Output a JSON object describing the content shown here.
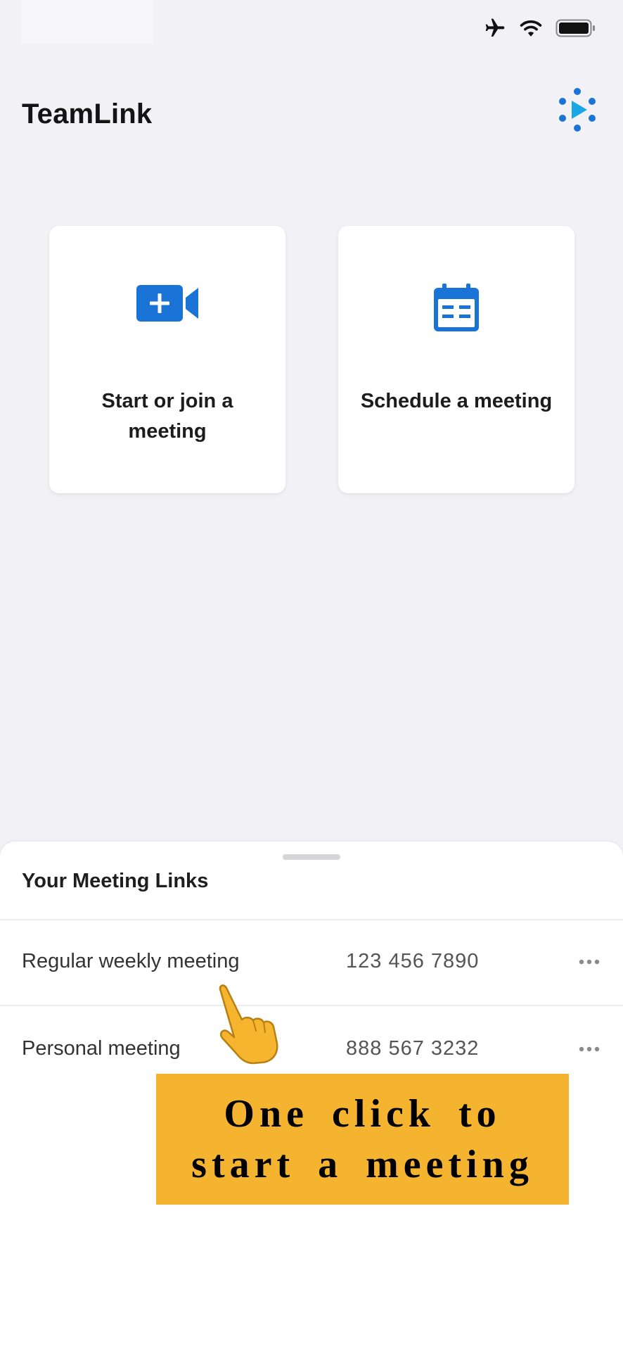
{
  "header": {
    "title": "TeamLink",
    "logo_icon": "teamlink-dots-play-logo"
  },
  "status_bar": {
    "icons": [
      "airplane-icon",
      "wifi-icon",
      "battery-icon"
    ]
  },
  "cards": [
    {
      "label": "Start or join a meeting",
      "icon": "video-plus-icon",
      "icon_color": "#1a73d6"
    },
    {
      "label": "Schedule a meeting",
      "icon": "calendar-icon",
      "icon_color": "#1a73d6"
    }
  ],
  "meeting_links": {
    "title": "Your Meeting Links",
    "items": [
      {
        "name": "Regular weekly meeting",
        "id": "123 456 7890",
        "more_icon": "more-horizontal-icon"
      },
      {
        "name": "Personal meeting",
        "id": "888 567 3232",
        "more_icon": "more-horizontal-icon"
      }
    ]
  },
  "overlay": {
    "pointer_icon": "hand-pointer-icon",
    "banner_line1": "One click to",
    "banner_line2": "start a meeting",
    "banner_color": "#f4b430"
  }
}
